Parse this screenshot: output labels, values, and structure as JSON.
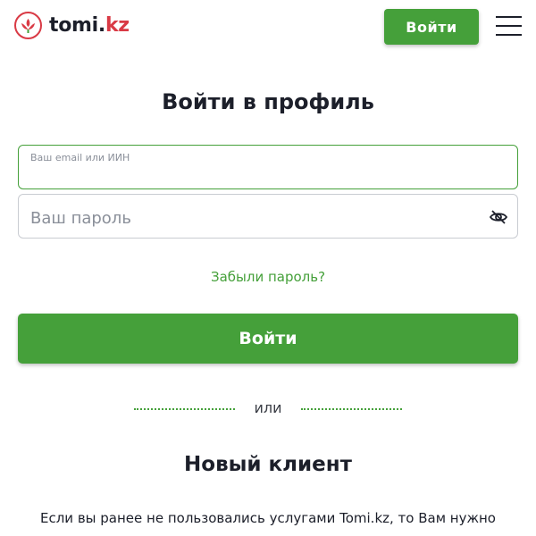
{
  "header": {
    "logo_text_main": "tomi.",
    "logo_text_tld": "kz",
    "login_button": "Войти",
    "menu_icon": "hamburger-icon"
  },
  "form": {
    "title": "Войти в профиль",
    "email_label": "Ваш email или ИИН",
    "email_value": "",
    "password_placeholder": "Ваш пароль",
    "password_toggle_icon": "eye-slash-icon",
    "forgot_link": "Забыли пароль?",
    "submit_button": "Войти"
  },
  "divider": {
    "text": "или"
  },
  "new_client": {
    "title": "Новый клиент",
    "text": "Если вы ранее не пользовались услугами Tomi.kz, то Вам нужно"
  },
  "colors": {
    "brand_green": "#45a03a",
    "brand_red": "#d93a45",
    "text_dark": "#1c1f2a"
  }
}
